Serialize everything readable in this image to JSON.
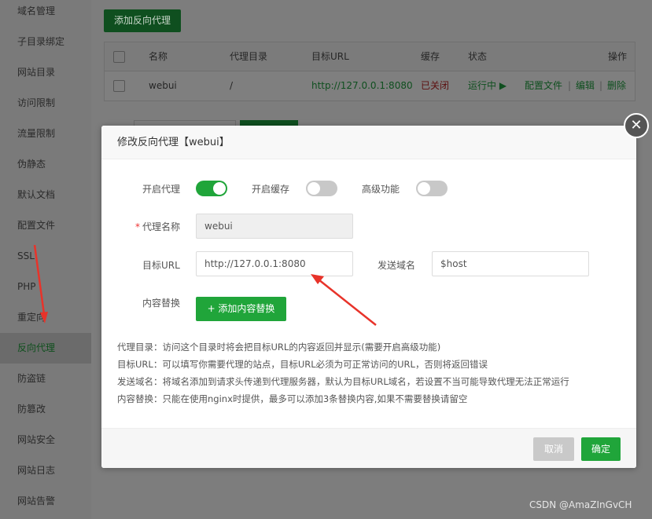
{
  "sidebar": {
    "items": [
      {
        "label": "域名管理"
      },
      {
        "label": "子目录绑定"
      },
      {
        "label": "网站目录"
      },
      {
        "label": "访问限制"
      },
      {
        "label": "流量限制"
      },
      {
        "label": "伪静态"
      },
      {
        "label": "默认文档"
      },
      {
        "label": "配置文件"
      },
      {
        "label": "SSL"
      },
      {
        "label": "PHP"
      },
      {
        "label": "重定向"
      },
      {
        "label": "反向代理",
        "active": true
      },
      {
        "label": "防盗链"
      },
      {
        "label": "防篡改"
      },
      {
        "label": "网站安全"
      },
      {
        "label": "网站日志"
      },
      {
        "label": "网站告警"
      }
    ]
  },
  "main": {
    "add_button": "添加反向代理",
    "table": {
      "headers": {
        "name": "名称",
        "proxy_dir": "代理目录",
        "target_url": "目标URL",
        "cache": "缓存",
        "status": "状态",
        "actions": "操作"
      },
      "rows": [
        {
          "name": "webui",
          "proxy_dir": "/",
          "target_url": "http://127.0.0.1:8080",
          "cache": "已关闭",
          "status": "运行中 ▶",
          "action_config": "配置文件",
          "action_edit": "编辑",
          "action_delete": "删除",
          "sep": "|"
        }
      ]
    }
  },
  "modal": {
    "title": "修改反向代理【webui】",
    "close_symbol": "✕",
    "enable_proxy": {
      "label": "开启代理",
      "on": true
    },
    "enable_cache": {
      "label": "开启缓存",
      "on": false
    },
    "advanced": {
      "label": "高级功能",
      "on": false
    },
    "proxy_name": {
      "required_mark": "*",
      "label": "代理名称",
      "value": "webui"
    },
    "target_url": {
      "label": "目标URL",
      "value": "http://127.0.0.1:8080"
    },
    "send_domain": {
      "label": "发送域名",
      "value": "$host"
    },
    "content_replace": {
      "label": "内容替换",
      "button": "+ 添加内容替换"
    },
    "notes": [
      "代理目录：访问这个目录时将会把目标URL的内容返回并显示(需要开启高级功能)",
      "目标URL：可以填写你需要代理的站点，目标URL必须为可正常访问的URL，否则将返回错误",
      "发送域名：将域名添加到请求头传递到代理服务器，默认为目标URL域名，若设置不当可能导致代理无法正常运行",
      "内容替换：只能在使用nginx时提供，最多可以添加3条替换内容,如果不需要替换请留空"
    ],
    "cancel": "取消",
    "confirm": "确定"
  },
  "colors": {
    "accent": "#20a53a",
    "annotation_arrow": "#e8332a",
    "danger": "#e33"
  },
  "watermark": "CSDN @AmaZInGvCH"
}
